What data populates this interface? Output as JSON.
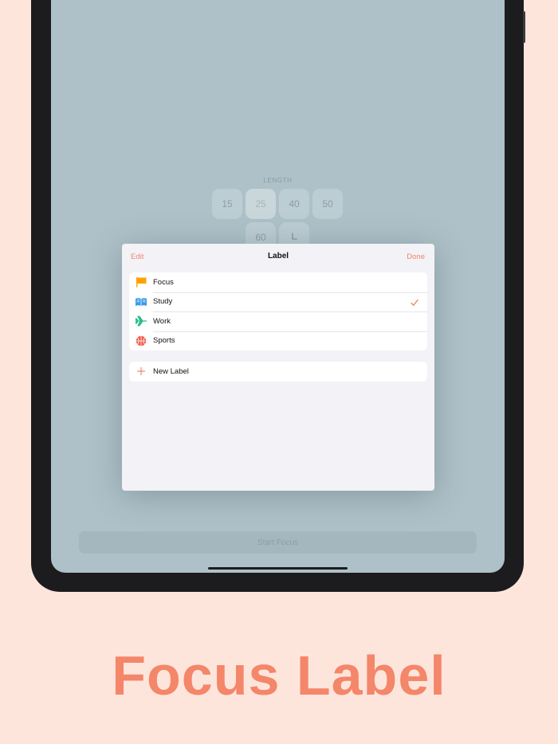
{
  "background": {
    "length_title": "LENGTH",
    "presets": [
      "15",
      "25",
      "40",
      "50",
      "60"
    ],
    "selected_preset": "25",
    "start_button": "Start Focus"
  },
  "sheet": {
    "edit": "Edit",
    "title": "Label",
    "done": "Done",
    "labels": [
      {
        "name": "Focus",
        "icon": "flag-icon",
        "color": "#ffa200"
      },
      {
        "name": "Study",
        "icon": "book-icon",
        "color": "#3a9be8"
      },
      {
        "name": "Work",
        "icon": "airplane-icon",
        "color": "#2bbd8c"
      },
      {
        "name": "Sports",
        "icon": "basketball-icon",
        "color": "#f05a4a"
      }
    ],
    "selected_label": "Study",
    "new_label": "New Label"
  },
  "promo": {
    "title": "Focus Label"
  },
  "colors": {
    "accent": "#f4866a",
    "page_background": "#fde5dc",
    "dimmed_screen": "#aec1c8"
  }
}
